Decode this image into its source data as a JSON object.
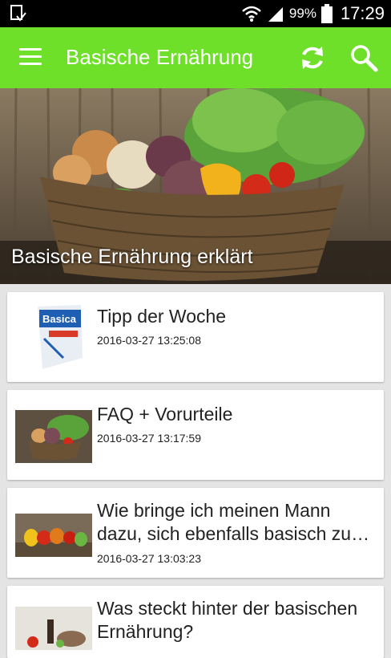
{
  "status": {
    "battery": "99%",
    "time": "17:29"
  },
  "appbar": {
    "title": "Basische Ernährung"
  },
  "hero": {
    "caption": "Basische Ernährung erklärt"
  },
  "articles": [
    {
      "title": "Tipp der Woche",
      "date": "2016-03-27 13:25:08",
      "thumb_label": "Basica"
    },
    {
      "title": "FAQ + Vorurteile",
      "date": "2016-03-27 13:17:59"
    },
    {
      "title": "Wie bringe ich meinen Mann dazu, sich ebenfalls basisch zu…",
      "date": "2016-03-27 13:03:23"
    },
    {
      "title": "Was steckt hinter der basischen Ernährung?",
      "date": ""
    }
  ],
  "colors": {
    "accent": "#6fe02a",
    "background": "#e4e4e4"
  }
}
